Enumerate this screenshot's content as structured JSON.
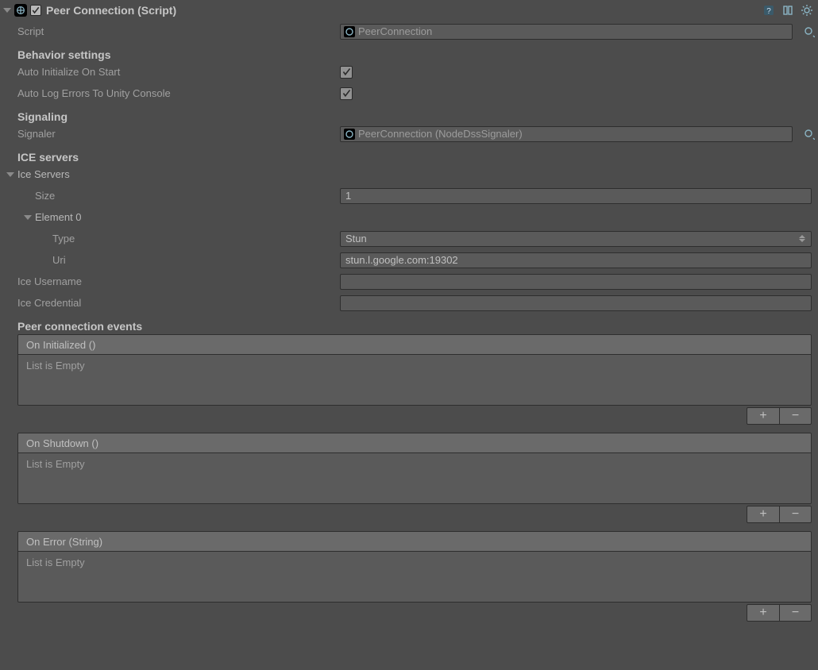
{
  "component": {
    "title": "Peer Connection (Script)",
    "enabled": true
  },
  "script": {
    "label": "Script",
    "value": "PeerConnection"
  },
  "behavior": {
    "heading": "Behavior settings",
    "autoInit": {
      "label": "Auto Initialize On Start",
      "checked": true
    },
    "autoLog": {
      "label": "Auto Log Errors To Unity Console",
      "checked": true
    }
  },
  "signaling": {
    "heading": "Signaling",
    "signaler": {
      "label": "Signaler",
      "value": "PeerConnection (NodeDssSignaler)"
    }
  },
  "ice": {
    "heading": "ICE servers",
    "listLabel": "Ice Servers",
    "size": {
      "label": "Size",
      "value": "1"
    },
    "elementLabel": "Element 0",
    "type": {
      "label": "Type",
      "value": "Stun"
    },
    "uri": {
      "label": "Uri",
      "value": "stun.l.google.com:19302"
    },
    "username": {
      "label": "Ice Username",
      "value": ""
    },
    "credential": {
      "label": "Ice Credential",
      "value": ""
    }
  },
  "events": {
    "heading": "Peer connection events",
    "emptyText": "List is Empty",
    "onInitialized": "On Initialized ()",
    "onShutdown": "On Shutdown ()",
    "onError": "On Error (String)"
  }
}
